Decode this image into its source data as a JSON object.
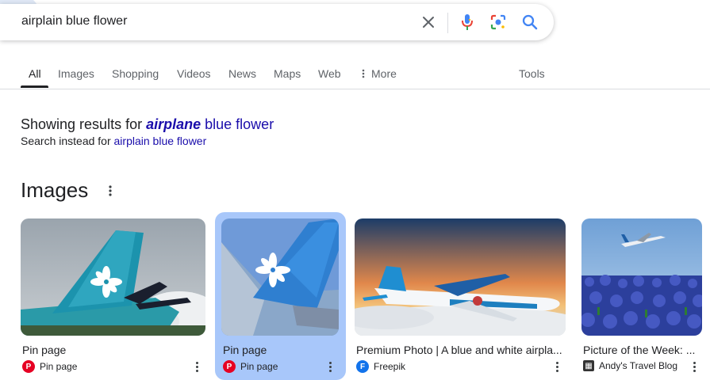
{
  "search": {
    "query": "airplain blue flower"
  },
  "tabs": [
    {
      "label": "All",
      "active": true
    },
    {
      "label": "Images"
    },
    {
      "label": "Shopping"
    },
    {
      "label": "Videos"
    },
    {
      "label": "News"
    },
    {
      "label": "Maps"
    },
    {
      "label": "Web"
    },
    {
      "label": "More"
    }
  ],
  "tools_label": "Tools",
  "spelling": {
    "showing_prefix": "Showing results for",
    "corrected_bold": "airplane",
    "corrected_rest": "blue flower",
    "instead_prefix": "Search instead for",
    "original_query": "airplain blue flower"
  },
  "images_section": {
    "heading": "Images",
    "cards": [
      {
        "title": "Pin page",
        "source": "Pin page",
        "favicon": "pinterest-icon",
        "favicon_color": "#e60023"
      },
      {
        "title": "Pin page",
        "source": "Pin page",
        "favicon": "pinterest-icon",
        "favicon_color": "#e60023",
        "selected": true
      },
      {
        "title": "Premium Photo | A blue and white airpla...",
        "source": "Freepik",
        "favicon": "freepik-icon",
        "favicon_color": "#1273eb"
      },
      {
        "title": "Picture of the Week: ...",
        "source": "Andy's Travel Blog",
        "favicon": "andys-travel-blog-icon",
        "favicon_color": "#333333"
      }
    ]
  },
  "colors": {
    "link": "#1a0dab",
    "selected_card": "#a8c7fa",
    "google_blue": "#4285f4"
  }
}
